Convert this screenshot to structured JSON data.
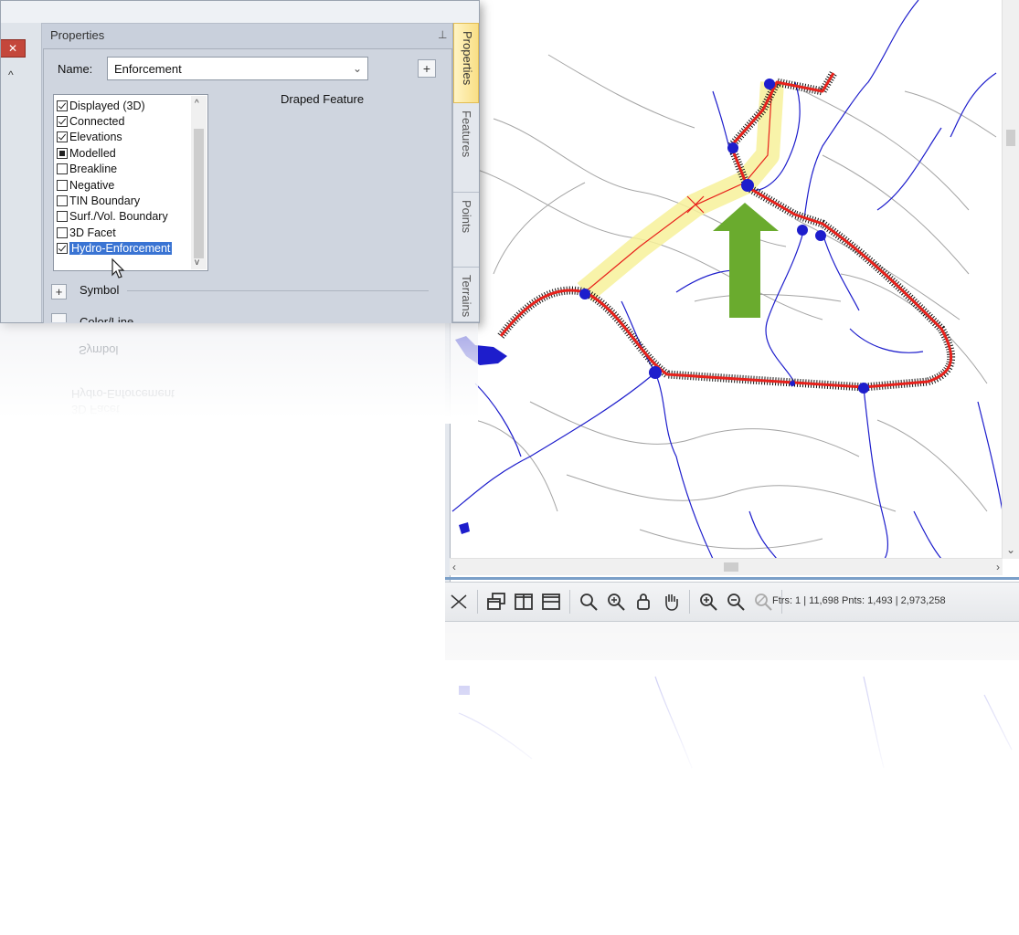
{
  "panel": {
    "title": "Properties",
    "name_label": "Name:",
    "name_value": "Enforcement",
    "add_label": "+",
    "feature_type": "Draped Feature",
    "flags": [
      {
        "label": "Displayed (3D)",
        "state": "checked"
      },
      {
        "label": "Connected",
        "state": "checked"
      },
      {
        "label": "Elevations",
        "state": "checked"
      },
      {
        "label": "Modelled",
        "state": "filled"
      },
      {
        "label": "Breakline",
        "state": "unchecked"
      },
      {
        "label": "Negative",
        "state": "unchecked"
      },
      {
        "label": "TIN Boundary",
        "state": "unchecked"
      },
      {
        "label": "Surf./Vol. Boundary",
        "state": "unchecked"
      },
      {
        "label": "3D Facet",
        "state": "unchecked"
      },
      {
        "label": "Hydro-Enforcement",
        "state": "checked",
        "selected": true
      }
    ],
    "sections": {
      "symbol_toggle": "+",
      "symbol_label": "Symbol",
      "color_line_label": "Color/Line"
    },
    "side_tabs": [
      "Properties",
      "Features",
      "Points",
      "Terrains"
    ]
  },
  "toolbar": {
    "status": "Ftrs: 1 | 11,698  Pnts: 1,493 | 2,973,258",
    "icons": [
      "select-icon",
      "cascade-windows-icon",
      "tile-vertical-icon",
      "tile-horizontal-icon",
      "zoom-icon",
      "zoom-window-icon",
      "lock-view-icon",
      "pan-hand-icon",
      "zoom-in-icon",
      "zoom-out-icon",
      "zoom-previous-icon"
    ]
  },
  "colors": {
    "stream": "#1d1dcc",
    "corridor": "#e8221c",
    "contour": "#9a9a9a",
    "highlight": "#f7f19a",
    "arrow": "#6aab2e",
    "selection": "#3a74d3"
  }
}
